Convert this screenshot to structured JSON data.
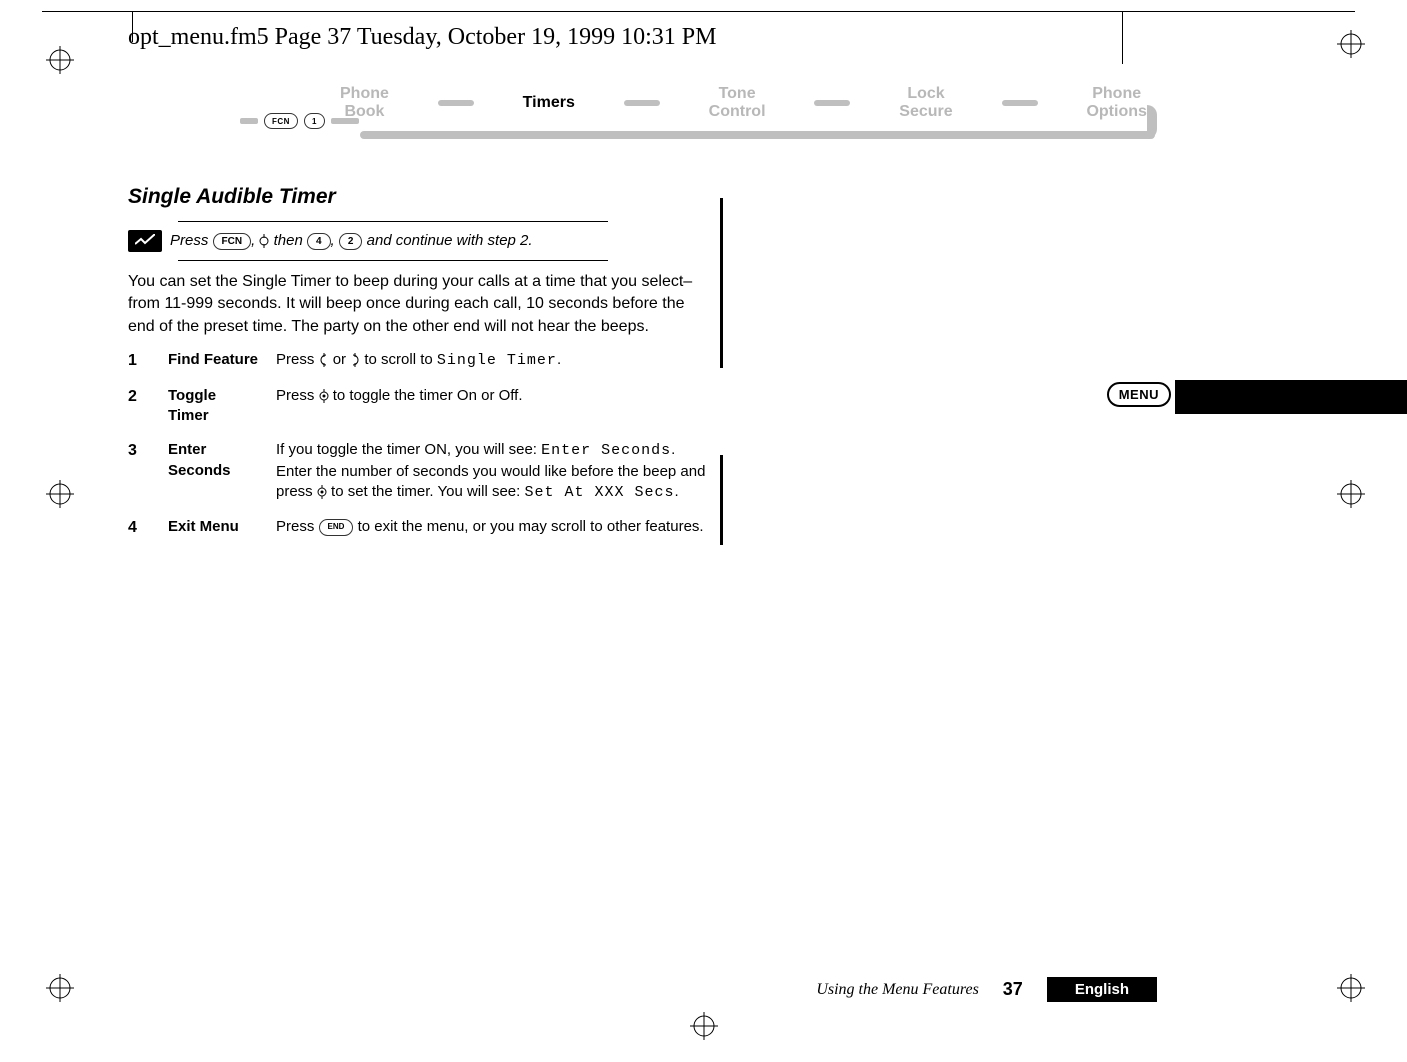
{
  "header": {
    "framemaker_line": "opt_menu.fm5  Page 37  Tuesday, October 19, 1999  10:31 PM"
  },
  "flow": {
    "fcn_label": "FCN",
    "one_label": "1",
    "items": [
      {
        "line1": "Phone",
        "line2": "Book",
        "active": false
      },
      {
        "line1": "Timers",
        "line2": "",
        "active": true
      },
      {
        "line1": "Tone",
        "line2": "Control",
        "active": false
      },
      {
        "line1": "Lock",
        "line2": "Secure",
        "active": false
      },
      {
        "line1": "Phone",
        "line2": "Options",
        "active": false
      }
    ]
  },
  "section": {
    "title": "Single Audible Timer",
    "shortcut": {
      "press": "Press ",
      "fcn": "FCN",
      "comma1": ", ",
      "then": " then ",
      "four": "4",
      "comma2": ", ",
      "two": "2",
      "tail": " and continue with step 2."
    },
    "paragraph": "You can set the Single Timer to beep during your calls at a time that you select–from 11-999 seconds. It will beep once during each call, 10 seconds before the end of the preset time. The party on the other end will not hear the beeps.",
    "steps": [
      {
        "num": "1",
        "label": "Find Feature",
        "pre": "Press ",
        "mid": " or ",
        "post_a": " to scroll to ",
        "mono": "Single Timer",
        "post_b": "."
      },
      {
        "num": "2",
        "label": "Toggle Timer",
        "pre": "Press ",
        "post": " to toggle the timer On or Off."
      },
      {
        "num": "3",
        "label": "Enter Seconds",
        "t1": "If you toggle the timer ON, you will see: ",
        "m1": "Enter Seconds",
        "t2": ". Enter the number of seconds you would like before the beep and press ",
        "t3": " to set the timer. You will see: ",
        "m2": "Set At XXX Secs",
        "t4": "."
      },
      {
        "num": "4",
        "label": "Exit Menu",
        "pre": "Press ",
        "end": "END",
        "post": " to exit the menu, or you may scroll to other features."
      }
    ]
  },
  "menu_tag": "MENU",
  "footer": {
    "title": "Using the Menu Features",
    "page": "37",
    "lang": "English"
  }
}
